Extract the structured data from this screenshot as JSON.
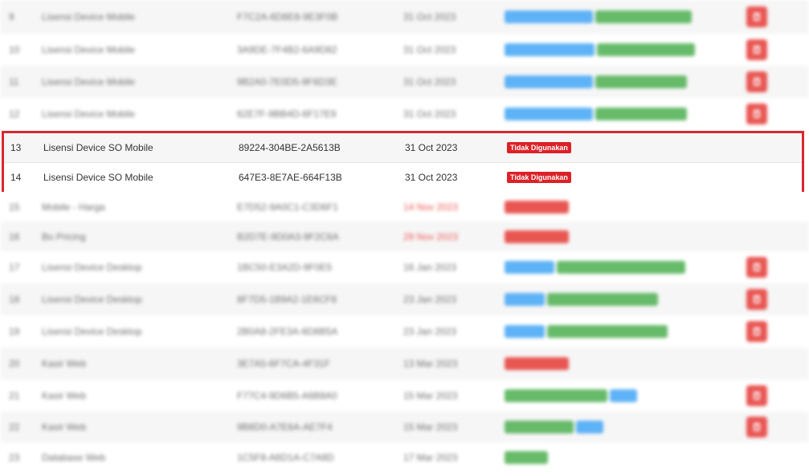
{
  "rows_top": [
    {
      "no": "9",
      "name": "Lisensi Device Mobile",
      "key": "F7C2A-6D8E8-9E3F0B",
      "date": "31 Oct 2023"
    },
    {
      "no": "10",
      "name": "Lisensi Device Mobile",
      "key": "3A9DE-7F4B2-6A9D82",
      "date": "31 Oct 2023"
    },
    {
      "no": "11",
      "name": "Lisensi Device Mobile",
      "key": "9B2A0-7E0D5-9F6D3E",
      "date": "31 Oct 2023"
    },
    {
      "no": "12",
      "name": "Lisensi Device Mobile",
      "key": "62E7F-9BB4D-6F17E9",
      "date": "31 Oct 2023"
    }
  ],
  "highlighted_rows": [
    {
      "no": "13",
      "name": "Lisensi Device SO Mobile",
      "key": "89224-304BE-2A5613B",
      "date": "31 Oct 2023",
      "status": "Tidak Digunakan"
    },
    {
      "no": "14",
      "name": "Lisensi Device SO Mobile",
      "key": "647E3-8E7AE-664F13B",
      "date": "31 Oct 2023",
      "status": "Tidak Digunakan"
    }
  ],
  "rows_bottom": [
    {
      "no": "15",
      "name": "Mobile - Harga",
      "key": "E7D52-9A0C1-C3D6F1",
      "date": "14 Nov 2023"
    },
    {
      "no": "16",
      "name": "Bo Pricing",
      "key": "B2D7E-9D0A3-9F2C6A",
      "date": "29 Nov 2023"
    },
    {
      "no": "17",
      "name": "Lisensi Device Desktop",
      "key": "1BC50-E3A2D-9F0E5",
      "date": "16 Jan 2023"
    },
    {
      "no": "18",
      "name": "Lisensi Device Desktop",
      "key": "8F7D5-1B9A2-1E6CF8",
      "date": "23 Jan 2023"
    },
    {
      "no": "19",
      "name": "Lisensi Device Desktop",
      "key": "2B0A8-2FE3A-6D8B5A",
      "date": "23 Jan 2023"
    },
    {
      "no": "20",
      "name": "Kasir Web",
      "key": "3E7A5-6F7CA-4F31F",
      "date": "13 Mar 2023"
    },
    {
      "no": "21",
      "name": "Kasir Web",
      "key": "F77C4-9D6B5-A6B8A0",
      "date": "15 Mar 2023"
    },
    {
      "no": "22",
      "name": "Kasir Web",
      "key": "9B8D0-A7E6A-AE7F4",
      "date": "15 Mar 2023"
    },
    {
      "no": "23",
      "name": "Database Web",
      "key": "1C5F8-A6D1A-C7A8D",
      "date": "17 Mar 2023"
    }
  ],
  "colors": {
    "highlight_border": "#d9272e",
    "badge_red": "#dc2127",
    "pill_blue": "#42a5f5",
    "pill_green": "#4caf50",
    "date_red": "#e53935"
  }
}
